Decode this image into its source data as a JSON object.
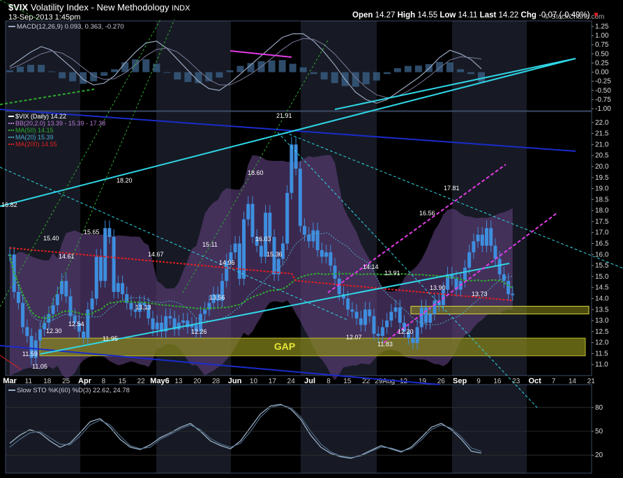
{
  "header": {
    "symbol": "$VIX",
    "name": "Volatility Index - New Methodology",
    "exchange": "INDX",
    "date": "13-Sep-2013 1:45pm",
    "watermark": "© StockCharts.com",
    "quote": {
      "open_label": "Open",
      "open": "14.27",
      "high_label": "High",
      "high": "14.55",
      "low_label": "Low",
      "low": "14.11",
      "last_label": "Last",
      "last": "14.22",
      "chg_label": "Chg",
      "chg": "-0.07 (-0.49%)"
    }
  },
  "colors": {
    "background": "#000000",
    "panel_border": "#3b4a66",
    "band_fill": "#5b3d78",
    "candles": "#3e8ede",
    "ma50": "#2faa2f",
    "ma20": "#4aa8c6",
    "ma200": "#e02020",
    "cyan_trend": "#2fd6e6",
    "blue_channel": "#1a2ccc",
    "magenta": "#e23ce6",
    "gap_box": "#8a8a1c",
    "macd_line": "#9aa8c0",
    "hist": "#3a5f84"
  },
  "chart_data": [
    {
      "type": "bar",
      "panel": "MACD",
      "label": "MACD(12,26,9) 0.093, 0.363, -0.270",
      "ylim": [
        -1.0,
        1.25
      ],
      "y_ticks": [
        "1.25",
        "1.00",
        "0.75",
        "0.50",
        "0.25",
        "0.00",
        "-0.25",
        "-0.50",
        "-0.75",
        "-1.00"
      ],
      "macd": [
        0.15,
        0.35,
        0.55,
        0.7,
        0.6,
        0.35,
        0.1,
        -0.2,
        -0.35,
        -0.3,
        -0.1,
        0.25,
        0.55,
        0.8,
        0.85,
        0.65,
        0.35,
        0.05,
        -0.25,
        -0.45,
        -0.5,
        -0.3,
        -0.05,
        0.2,
        0.45,
        0.7,
        0.95,
        1.05,
        1.05,
        0.85,
        0.55,
        0.2,
        -0.2,
        -0.55,
        -0.75,
        -0.85,
        -0.75,
        -0.55,
        -0.35,
        -0.15,
        0.1,
        0.4,
        0.6,
        0.5,
        0.35,
        0.09
      ],
      "signal": [
        0.1,
        0.2,
        0.35,
        0.5,
        0.58,
        0.52,
        0.35,
        0.12,
        -0.1,
        -0.2,
        -0.18,
        -0.02,
        0.2,
        0.45,
        0.62,
        0.66,
        0.55,
        0.32,
        0.05,
        -0.2,
        -0.35,
        -0.35,
        -0.22,
        -0.05,
        0.15,
        0.38,
        0.62,
        0.82,
        0.92,
        0.9,
        0.75,
        0.5,
        0.18,
        -0.15,
        -0.42,
        -0.62,
        -0.7,
        -0.66,
        -0.52,
        -0.33,
        -0.12,
        0.12,
        0.33,
        0.42,
        0.4,
        0.36
      ]
    },
    {
      "type": "line",
      "panel": "Price",
      "title": "$VIX (Daily) 14.22",
      "legend": [
        "$VIX (Daily) 14.22",
        "BB(20,2.0) 13.39 - 15.39 - 17.38",
        "MA(50) 14.15",
        "MA(20) 15.39",
        "MA(200) 14.55"
      ],
      "ylim": [
        10.5,
        22.5
      ],
      "y_ticks": [
        "22.0",
        "21.5",
        "21.0",
        "20.5",
        "20.0",
        "19.5",
        "19.0",
        "18.5",
        "18.0",
        "17.5",
        "17.0",
        "16.5",
        "16.0",
        "15.5",
        "15.0",
        "14.5",
        "14.0",
        "13.5",
        "13.0",
        "12.5",
        "12.0",
        "11.5",
        "11.0"
      ],
      "x_labels": [
        "Mar",
        "11",
        "18",
        "25",
        "Apr",
        "8",
        "15",
        "22",
        "May6",
        "13",
        "20",
        "28",
        "Jun",
        "10",
        "17",
        "24",
        "Jul",
        "8",
        "15",
        "22",
        "29Aug",
        "12",
        "19",
        "26",
        "Sep",
        "9",
        "16",
        "23",
        "Oct",
        "7",
        "14",
        "21"
      ],
      "close": [
        16.0,
        14.3,
        13.8,
        12.7,
        12.3,
        11.3,
        12.1,
        12.6,
        12.9,
        13.3,
        13.7,
        14.2,
        14.8,
        14.1,
        13.2,
        12.9,
        12.5,
        12.2,
        13.5,
        14.0,
        15.9,
        14.8,
        17.2,
        16.8,
        14.3,
        14.7,
        14.2,
        13.8,
        13.5,
        13.4,
        13.8,
        13.7,
        13.1,
        12.6,
        12.9,
        12.5,
        13.2,
        13.1,
        12.6,
        12.9,
        13.0,
        12.7,
        12.8,
        12.5,
        13.3,
        13.5,
        13.8,
        14.2,
        13.9,
        14.8,
        15.7,
        16.1,
        16.5,
        14.9,
        17.6,
        18.3,
        16.8,
        16.4,
        15.9,
        17.9,
        16.8,
        15.1,
        15.8,
        16.5,
        18.8,
        21.0,
        19.9,
        17.3,
        16.9,
        16.6,
        17.1,
        16.2,
        15.9,
        16.1,
        15.5,
        14.9,
        14.2,
        14.0,
        13.5,
        13.4,
        13.1,
        12.8,
        13.5,
        13.2,
        12.4,
        12.3,
        12.7,
        13.0,
        13.4,
        13.6,
        12.9,
        12.5,
        12.2,
        11.98,
        12.7,
        13.6,
        12.9,
        13.3,
        13.9,
        13.7,
        14.4,
        15.1,
        14.9,
        14.4,
        14.8,
        15.4,
        16.1,
        16.6,
        16.9,
        16.4,
        17.2,
        16.4,
        15.8,
        15.1,
        14.8,
        14.2,
        14.22
      ],
      "labels": [
        "16.82",
        "15.40",
        "14.61",
        "12.54",
        "12.30",
        "11.59",
        "11.05",
        "15.65",
        "18.20",
        "11.95",
        "14.67",
        "13.13",
        "12.26",
        "15.11",
        "13.56",
        "14.96",
        "18.60",
        "16.03",
        "15.36",
        "21.91",
        "14.14",
        "12.07",
        "11.83",
        "13.91",
        "12.20",
        "16.56",
        "13.90",
        "17.81",
        "13.73"
      ],
      "gap_label": "GAP",
      "gap_zone": [
        11.65,
        11.95
      ],
      "support_zone": [
        13.3,
        13.65
      ]
    },
    {
      "type": "line",
      "panel": "Slow STO",
      "label": "Slow STO %K(60) %D(3) 22.62, 24.78",
      "ylim": [
        0,
        100
      ],
      "y_ticks": [
        "80",
        "50",
        "20"
      ],
      "k": [
        35,
        45,
        52,
        48,
        38,
        30,
        35,
        48,
        62,
        66,
        55,
        40,
        30,
        27,
        33,
        42,
        48,
        55,
        60,
        50,
        38,
        32,
        28,
        38,
        55,
        72,
        82,
        84,
        78,
        65,
        45,
        30,
        22,
        18,
        16,
        20,
        26,
        32,
        28,
        24,
        30,
        42,
        55,
        60,
        52,
        40,
        25,
        22.62
      ],
      "d": [
        30,
        40,
        48,
        50,
        42,
        34,
        33,
        44,
        58,
        64,
        58,
        44,
        32,
        28,
        30,
        40,
        46,
        53,
        58,
        52,
        41,
        34,
        30,
        35,
        50,
        68,
        80,
        83,
        80,
        68,
        50,
        34,
        24,
        19,
        17,
        19,
        25,
        30,
        29,
        25,
        28,
        39,
        52,
        58,
        54,
        43,
        29,
        24.78
      ]
    }
  ]
}
